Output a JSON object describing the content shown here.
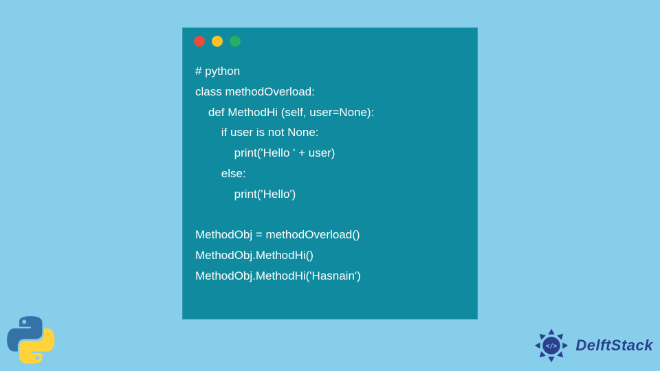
{
  "code": {
    "lines": [
      "# python",
      "class methodOverload:",
      "    def MethodHi (self, user=None):",
      "        if user is not None:",
      "            print('Hello ' + user)",
      "        else:",
      "            print('Hello')",
      "",
      "MethodObj = methodOverload()",
      "MethodObj.MethodHi()",
      "MethodObj.MethodHi('Hasnain')"
    ]
  },
  "logos": {
    "python": "python-logo",
    "delftstack_text": "DelftStack"
  },
  "window": {
    "controls": [
      "close",
      "minimize",
      "maximize"
    ]
  }
}
